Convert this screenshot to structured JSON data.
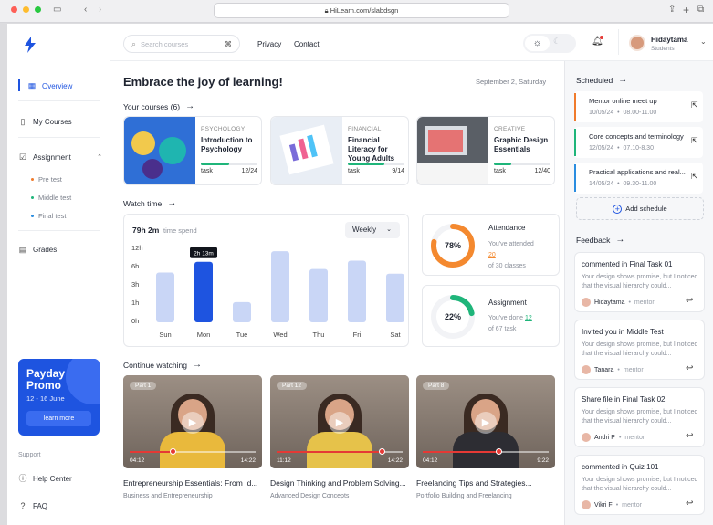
{
  "browser": {
    "url": "HiLearn.com/slabdsgn"
  },
  "sidebar": {
    "nav": [
      {
        "label": "Overview",
        "icon": "grid-icon"
      },
      {
        "label": "My Courses",
        "icon": "book-icon"
      },
      {
        "label": "Assignment",
        "icon": "checkbox-icon"
      }
    ],
    "sub": [
      "Pre test",
      "Middle test",
      "Final test"
    ],
    "grades": "Grades",
    "promo": {
      "title": "Payday Promo",
      "dates": "12 - 16 June",
      "button": "learn more"
    },
    "support_label": "Support",
    "help": "Help Center",
    "faq": "FAQ"
  },
  "topbar": {
    "search_placeholder": "Search courses",
    "shortcut": "⌘",
    "links": [
      "Privacy",
      "Contact"
    ],
    "user": {
      "name": "Hidaytama",
      "role": "Students"
    }
  },
  "main": {
    "heading": "Embrace the joy of learning!",
    "date": "September 2, Saturday",
    "courses_title": "Your courses (6)",
    "courses": [
      {
        "tag": "PSYCHOLOGY",
        "title": "Introduction to Psychology",
        "task_label": "task",
        "progress_text": "12/24",
        "progress": 0.5
      },
      {
        "tag": "FINANCIAL",
        "title": "Financial Literacy for Young Adults",
        "task_label": "task",
        "progress_text": "9/14",
        "progress": 0.64
      },
      {
        "tag": "CREATIVE",
        "title": "Graphic Design Essentials",
        "task_label": "task",
        "progress_text": "12/40",
        "progress": 0.3
      }
    ],
    "watch_title": "Watch time",
    "watch_total": "79h 2m",
    "watch_total_label": "time spend",
    "period": "Weekly",
    "tooltip": "2h 13m",
    "attendance": {
      "title": "Attendance",
      "percent": "78%",
      "line1": "You've attended",
      "count": "20",
      "line2": "of 30 classes",
      "value": 0.78
    },
    "assignment": {
      "title": "Assignment",
      "percent": "22%",
      "line1": "You've done",
      "count": "12",
      "line2": "of 67 task",
      "value": 0.22
    },
    "continue_title": "Continue watching",
    "videos": [
      {
        "part": "Part 1",
        "start": "04:12",
        "end": "14:22",
        "progress": 0.34,
        "title": "Entrepreneurship Essentials: From Id...",
        "subtitle": "Business and Entrepreneurship"
      },
      {
        "part": "Part 12",
        "start": "11:12",
        "end": "14:22",
        "progress": 0.83,
        "title": "Design Thinking and Problem Solving...",
        "subtitle": "Advanced Design Concepts"
      },
      {
        "part": "Part 8",
        "start": "04:12",
        "end": "9:22",
        "progress": 0.6,
        "title": "Freelancing Tips and Strategies...",
        "subtitle": "Portfolio Building and Freelancing"
      }
    ]
  },
  "chart_data": {
    "type": "bar",
    "categories": [
      "Sun",
      "Mon",
      "Tue",
      "Wed",
      "Thu",
      "Fri",
      "Sat"
    ],
    "values": [
      4.2,
      5.1,
      1.7,
      6.0,
      4.5,
      5.2,
      4.1
    ],
    "yticks": [
      "12h",
      "6h",
      "3h",
      "1h",
      "0h"
    ],
    "highlight": "Mon",
    "colors": {
      "bar": "#c9d6f6",
      "highlight": "#1e54e0"
    }
  },
  "right": {
    "scheduled_title": "Scheduled",
    "schedule": [
      {
        "title": "Mentor online meet up",
        "date": "10/05/24",
        "time": "08.00-11.00",
        "color": "#f07b2c"
      },
      {
        "title": "Core concepts and terminology",
        "date": "12/05/24",
        "time": "07.10-8.30",
        "color": "#1fb57a"
      },
      {
        "title": "Practical applications and real...",
        "date": "14/05/24",
        "time": "09.30-11.00",
        "color": "#2a8de0"
      }
    ],
    "add_schedule": "Add schedule",
    "feedback_title": "Feedback",
    "feedback": [
      {
        "action": "commented in",
        "target": "Final Task 01",
        "text": "Your design shows promise, but I noticed that the visual hierarchy could...",
        "name": "Hidaytama",
        "role": "mentor"
      },
      {
        "action": "Invited you in",
        "target": "Middle Test",
        "text": "Your design shows promise, but I noticed that the visual hierarchy could...",
        "name": "Tanara",
        "role": "mentor"
      },
      {
        "action": "Share file in",
        "target": "Final Task 02",
        "text": "Your design shows promise, but I noticed that the visual hierarchy could...",
        "name": "Andri P",
        "role": "mentor"
      },
      {
        "action": "commented in",
        "target": "Quiz 101",
        "text": "Your design shows promise, but I noticed that the visual hierarchy could...",
        "name": "Vikri F",
        "role": "mentor"
      }
    ]
  }
}
